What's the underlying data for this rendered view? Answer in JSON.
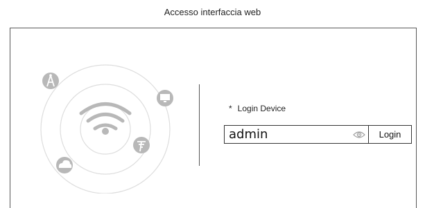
{
  "page": {
    "title": "Accesso interfaccia web"
  },
  "illustration": {
    "center_icon": "wifi-icon",
    "satellite_icons": [
      "antenna-icon",
      "monitor-icon",
      "signal-tower-icon",
      "cloud-icon"
    ],
    "ring_color": "#dddddd",
    "icon_color": "#b8b8b8"
  },
  "login": {
    "required_marker": "*",
    "label": "Login Device",
    "input_value": "admin",
    "reveal_icon": "eye-icon",
    "button_label": "Login"
  }
}
